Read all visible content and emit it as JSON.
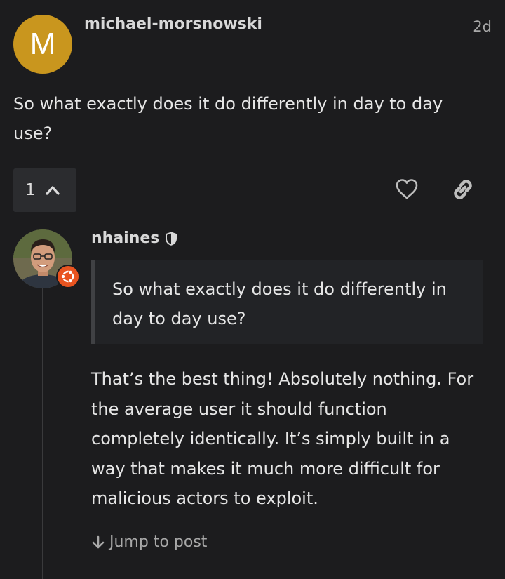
{
  "post1": {
    "avatar_letter": "M",
    "username": "michael-morsnowski",
    "date": "2d",
    "body": "So what exactly does it do differently in day to day use?",
    "reply_count": "1"
  },
  "post2": {
    "username": "nhaines",
    "quote": "So what exactly does it do differently in day to day use?",
    "body": "That’s the best thing! Absolutely nothing. For the average user it should function completely identically. It’s simply built in a way that makes it much more difficult for malicious actors to exploit.",
    "jump_label": "Jump to post"
  },
  "icons": {
    "reply_toggle": "chevron-up-icon",
    "like": "heart-icon",
    "share": "link-icon",
    "moderator": "shield-icon",
    "flair": "ubuntu-logo-icon",
    "jump": "arrow-down-icon"
  },
  "colors": {
    "background": "#1c1c1e",
    "avatar_m": "#c9961e",
    "flair": "#e95420"
  }
}
